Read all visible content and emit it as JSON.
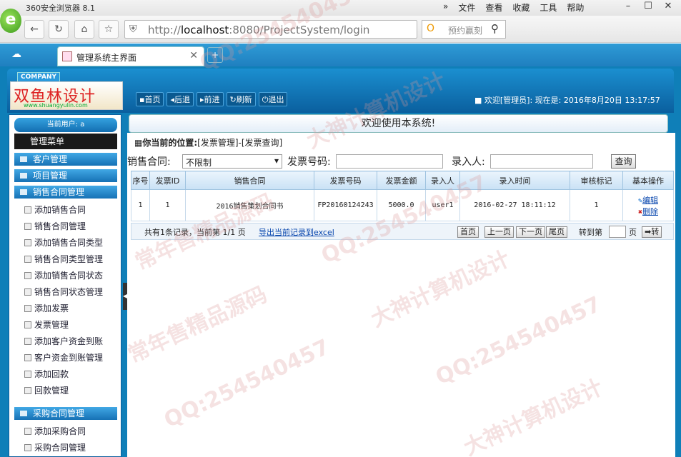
{
  "browser": {
    "app_title": "360安全浏览器 8.1",
    "menus": [
      "文件",
      "查看",
      "收藏",
      "工具",
      "帮助"
    ],
    "url_host": "localhost",
    "url_rest": ":8080/ProjectSystem/login",
    "url_prefix": "http://",
    "search_placeholder": "预约赢刻",
    "tab_title": "管理系统主界面"
  },
  "header": {
    "company": "COMPANY",
    "brand": "双鱼林设计",
    "brand_url": "www.shuangyulin.com",
    "nav": [
      "首页",
      "后退",
      "前进",
      "刷新",
      "退出"
    ],
    "welcome": "欢迎[管理员]:",
    "time": "现在是: 2016年8月20日 13:17:57"
  },
  "sidebar": {
    "current_user": "当前用户: a",
    "menu_title": "管理菜单",
    "groups": [
      {
        "label": "客户管理",
        "items": []
      },
      {
        "label": "项目管理",
        "items": []
      },
      {
        "label": "销售合同管理",
        "items": [
          "添加销售合同",
          "销售合同管理",
          "添加销售合同类型",
          "销售合同类型管理",
          "添加销售合同状态",
          "销售合同状态管理",
          "添加发票",
          "发票管理",
          "添加客户资金到账",
          "客户资金到账管理",
          "添加回款",
          "回款管理"
        ]
      },
      {
        "label": "采购合同管理",
        "items": [
          "添加采购合同",
          "采购合同管理"
        ]
      }
    ]
  },
  "main": {
    "banner": "欢迎使用本系统!",
    "location_label": "你当前的位置:",
    "location_path": "[发票管理]-[发票查询]",
    "filter": {
      "contract_label": "销售合同:",
      "contract_value": "不限制",
      "invoice_no_label": "发票号码:",
      "recorder_label": "录入人:",
      "query_button": "查询"
    },
    "table": {
      "headers": [
        "序号",
        "发票ID",
        "销售合同",
        "发票号码",
        "发票金额",
        "录入人",
        "录入时间",
        "审核标记",
        "基本操作"
      ],
      "rows": [
        [
          "1",
          "1",
          "2016销售策划合同书",
          "FP20160124243",
          "5000.0",
          "user1",
          "2016-02-27 18:11:12",
          "1"
        ]
      ],
      "ops": [
        "编辑",
        "删除"
      ]
    },
    "pager": {
      "info": "共有1条记录，当前第 1/1 页",
      "export": "导出当前记录到excel",
      "first": "首页",
      "prev": "上一页",
      "next": "下一页",
      "last": "尾页",
      "goto": "转到第",
      "page_unit": "页",
      "go": "转"
    }
  },
  "watermarks": [
    "QQ:254540457",
    "大神计算机设计",
    "常年售精品源码"
  ]
}
